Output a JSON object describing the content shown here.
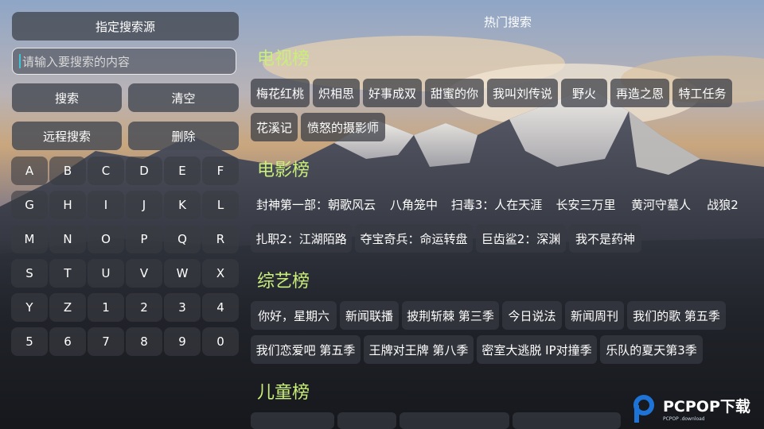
{
  "left": {
    "source_button": "指定搜索源",
    "search_placeholder": "请输入要搜索的内容",
    "search_button": "搜索",
    "clear_button": "清空",
    "remote_button": "远程搜索",
    "delete_button": "删除",
    "keys": [
      "A",
      "B",
      "C",
      "D",
      "E",
      "F",
      "G",
      "H",
      "I",
      "J",
      "K",
      "L",
      "M",
      "N",
      "O",
      "P",
      "Q",
      "R",
      "S",
      "T",
      "U",
      "V",
      "W",
      "X",
      "Y",
      "Z",
      "1",
      "2",
      "3",
      "4",
      "5",
      "6",
      "7",
      "8",
      "9",
      "0"
    ]
  },
  "right": {
    "title": "热门搜索",
    "tv": {
      "title": "电视榜",
      "row1": [
        "梅花红桃",
        "炽相思",
        "好事成双",
        "甜蜜的你",
        "我叫刘传说",
        "野火",
        "再造之恩",
        "特工任务"
      ],
      "row2": [
        "花溪记",
        "愤怒的摄影师"
      ]
    },
    "movie": {
      "title": "电影榜",
      "row1": [
        "封神第一部：朝歌风云",
        "八角笼中",
        "扫毒3：人在天涯",
        "长安三万里",
        "黄河守墓人",
        "战狼2"
      ],
      "row2": [
        "扎职2：江湖陌路",
        "夺宝奇兵：命运转盘",
        "巨齿鲨2：深渊",
        "我不是药神"
      ]
    },
    "variety": {
      "title": "综艺榜",
      "row1": [
        "你好，星期六",
        "新闻联播",
        "披荆斩棘 第三季",
        "今日说法",
        "新闻周刊",
        "我们的歌 第五季"
      ],
      "row2": [
        "我们恋爱吧 第五季",
        "王牌对王牌 第八季",
        "密室大逃脱 IP对撞季",
        "乐队的夏天第3季"
      ]
    },
    "kids": {
      "title": "儿童榜"
    }
  },
  "watermark": {
    "brand": "PCPOP下载",
    "sub": "PCPOP .download"
  },
  "colors": {
    "section_title": "#c9ee7a",
    "caret": "#3fc4d8",
    "logo_blue": "#1e73d6"
  }
}
